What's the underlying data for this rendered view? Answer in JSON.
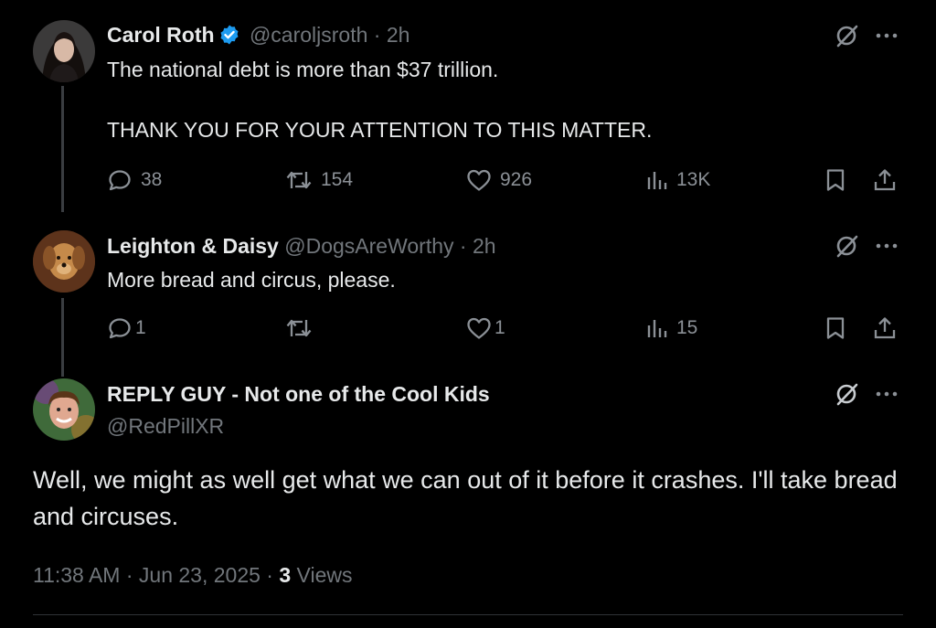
{
  "posts": [
    {
      "name": "Carol Roth",
      "handle": "@caroljsroth",
      "time": "2h",
      "verified": true,
      "text_lines": [
        "The national debt is more than $37 trillion.",
        "",
        "THANK YOU FOR YOUR ATTENTION TO THIS MATTER."
      ],
      "replies": "38",
      "reposts": "154",
      "likes": "926",
      "views": "13K"
    },
    {
      "name": "Leighton & Daisy",
      "handle": "@DogsAreWorthy",
      "time": "2h",
      "verified": false,
      "text_lines": [
        "More bread and circus, please."
      ],
      "replies": "1",
      "reposts": "",
      "likes": "1",
      "views": "15"
    },
    {
      "name": "REPLY GUY - Not one of the Cool Kids",
      "handle": "@RedPillXR",
      "text": "Well, we might as well get what we can out of it before it crashes. I'll take bread and circuses.",
      "timestamp": "11:38 AM · Jun 23, 2025 · ",
      "view_count": "3",
      "views_label": " Views"
    }
  ],
  "separator": "·",
  "icons": [
    "grok-icon",
    "more-icon",
    "reply-icon",
    "repost-icon",
    "like-icon",
    "views-icon",
    "bookmark-icon",
    "share-icon",
    "verified-badge-icon"
  ],
  "colors": {
    "background": "#000000",
    "text": "#e7e9ea",
    "muted": "#71767b",
    "verified": "#1d9bf0",
    "thread_line": "#3a3d41"
  }
}
